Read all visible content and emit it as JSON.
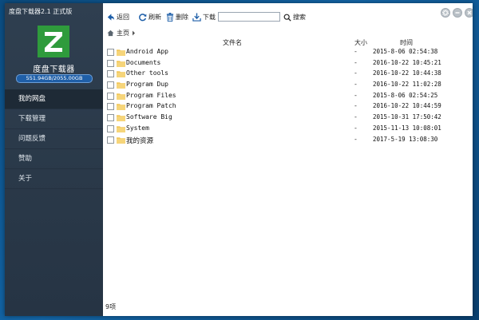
{
  "app": {
    "title": "度盘下载器2.1 正式版",
    "name": "度盘下载器",
    "storage": "551.94GB/2055.00GB"
  },
  "nav": {
    "items": [
      {
        "label": "我的网盘",
        "active": true
      },
      {
        "label": "下载管理"
      },
      {
        "label": "问题反馈"
      },
      {
        "label": "赞助"
      },
      {
        "label": "关于"
      }
    ]
  },
  "toolbar": {
    "back_label": "返回",
    "refresh_label": "刷新",
    "delete_label": "删除",
    "download_label": "下载",
    "search_value": "",
    "search_label": "搜索"
  },
  "breadcrumb": {
    "home": "主页"
  },
  "table": {
    "columns": {
      "name": "文件名",
      "size": "大小",
      "time": "时间"
    },
    "rows": [
      {
        "name": "Android App",
        "size": "-",
        "time": "2015-8-06 02:54:38"
      },
      {
        "name": "Documents",
        "size": "-",
        "time": "2016-10-22 10:45:21"
      },
      {
        "name": "Other tools",
        "size": "-",
        "time": "2016-10-22 10:44:38"
      },
      {
        "name": "Program Dup",
        "size": "-",
        "time": "2016-10-22 11:02:28"
      },
      {
        "name": "Program Files",
        "size": "-",
        "time": "2015-8-06 02:54:25"
      },
      {
        "name": "Program Patch",
        "size": "-",
        "time": "2016-10-22 10:44:59"
      },
      {
        "name": "Software Big",
        "size": "-",
        "time": "2015-10-31 17:50:42"
      },
      {
        "name": "System",
        "size": "-",
        "time": "2015-11-13 10:08:01"
      },
      {
        "name": "我的资源",
        "size": "-",
        "time": "2017-5-19 13:08:30"
      }
    ]
  },
  "status": {
    "count": "9项"
  },
  "colors": {
    "sidebar": "#2f3f50",
    "folder": "#f2c75a",
    "logo": "#2f9b3c",
    "storage_bar": "#1f5fa8"
  }
}
